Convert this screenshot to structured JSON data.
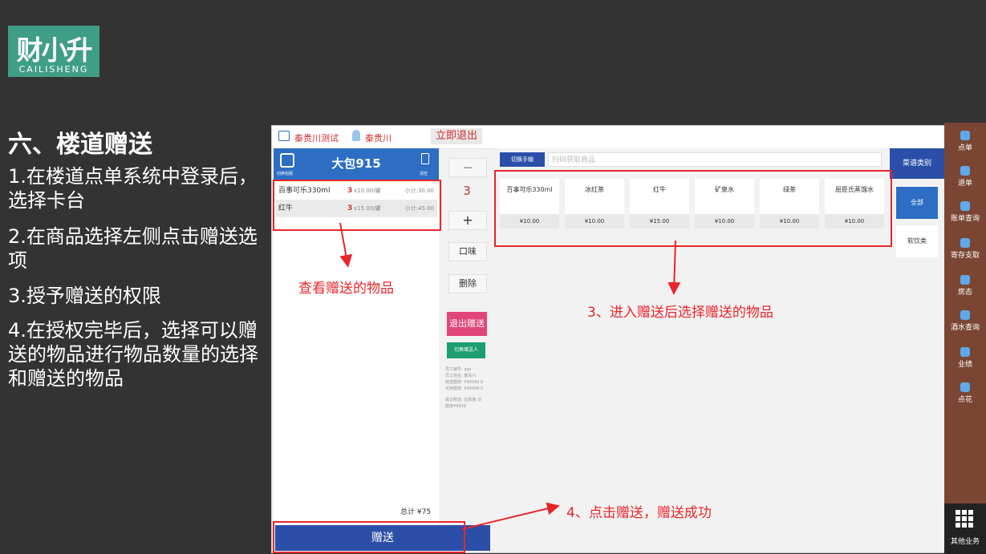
{
  "logo": {
    "cn": "财小升",
    "en": "CAILISHENG"
  },
  "slide": {
    "title": "六、楼道赠送",
    "steps": [
      "1.在楼道点单系统中登录后，选择卡台",
      "2.在商品选择左侧点击赠送选项",
      "3.授予赠送的权限",
      "4.在授权完毕后，选择可以赠送的物品进行物品数量的选择和赠送的物品"
    ]
  },
  "app": {
    "store": "秦贵川测试",
    "user": "秦贵川",
    "logout": "立即退出",
    "switch_label": "切换包厢",
    "room": "大包915",
    "clear": "清空",
    "order_items": [
      {
        "name": "百事可乐330ml",
        "qty": "3",
        "unit_price": "x10.00/罐",
        "subtotal": "小计:30.00"
      },
      {
        "name": "红牛",
        "qty": "3",
        "unit_price": "x15.00/罐",
        "subtotal": "小计:45.00"
      }
    ],
    "minus": "—",
    "qty_display": "3",
    "plus": "+",
    "taste": "口味",
    "delete": "删除",
    "exit_gift": "退出赠送",
    "switch_gift": "切换赠送人",
    "info": [
      "员工编号: qgs",
      "员工姓名: 秦贵川",
      "赠送额度: ¥99999.0",
      "可用额度: ¥99999.0",
      "",
      "最近赠送: 总额度-日",
      "额度¥9999"
    ],
    "total": "总计 ¥75",
    "gift_button": "赠送",
    "scan_button": "切换手输",
    "scan_placeholder": "扫码获取商品.",
    "products": [
      {
        "name": "百事可乐330ml",
        "price": "¥10.00"
      },
      {
        "name": "冰红茶",
        "price": "¥10.00"
      },
      {
        "name": "红牛",
        "price": "¥15.00"
      },
      {
        "name": "矿泉水",
        "price": "¥10.00"
      },
      {
        "name": "绿茶",
        "price": "¥10.00"
      },
      {
        "name": "屈臣氏蒸馏水",
        "price": "¥10.00"
      }
    ],
    "category_header": "菜谱类别",
    "categories": [
      "全部",
      "软饮类"
    ]
  },
  "sidebar": {
    "items": [
      "点单",
      "退单",
      "账单查询",
      "寄存支取",
      "房态",
      "酒水查询",
      "业绩",
      "点花"
    ],
    "other": "其他业务"
  },
  "annotations": {
    "a1": "查看赠送的物品",
    "a3": "3、进入赠送后选择赠送的物品",
    "a4": "4、点击赠送，赠送成功"
  }
}
